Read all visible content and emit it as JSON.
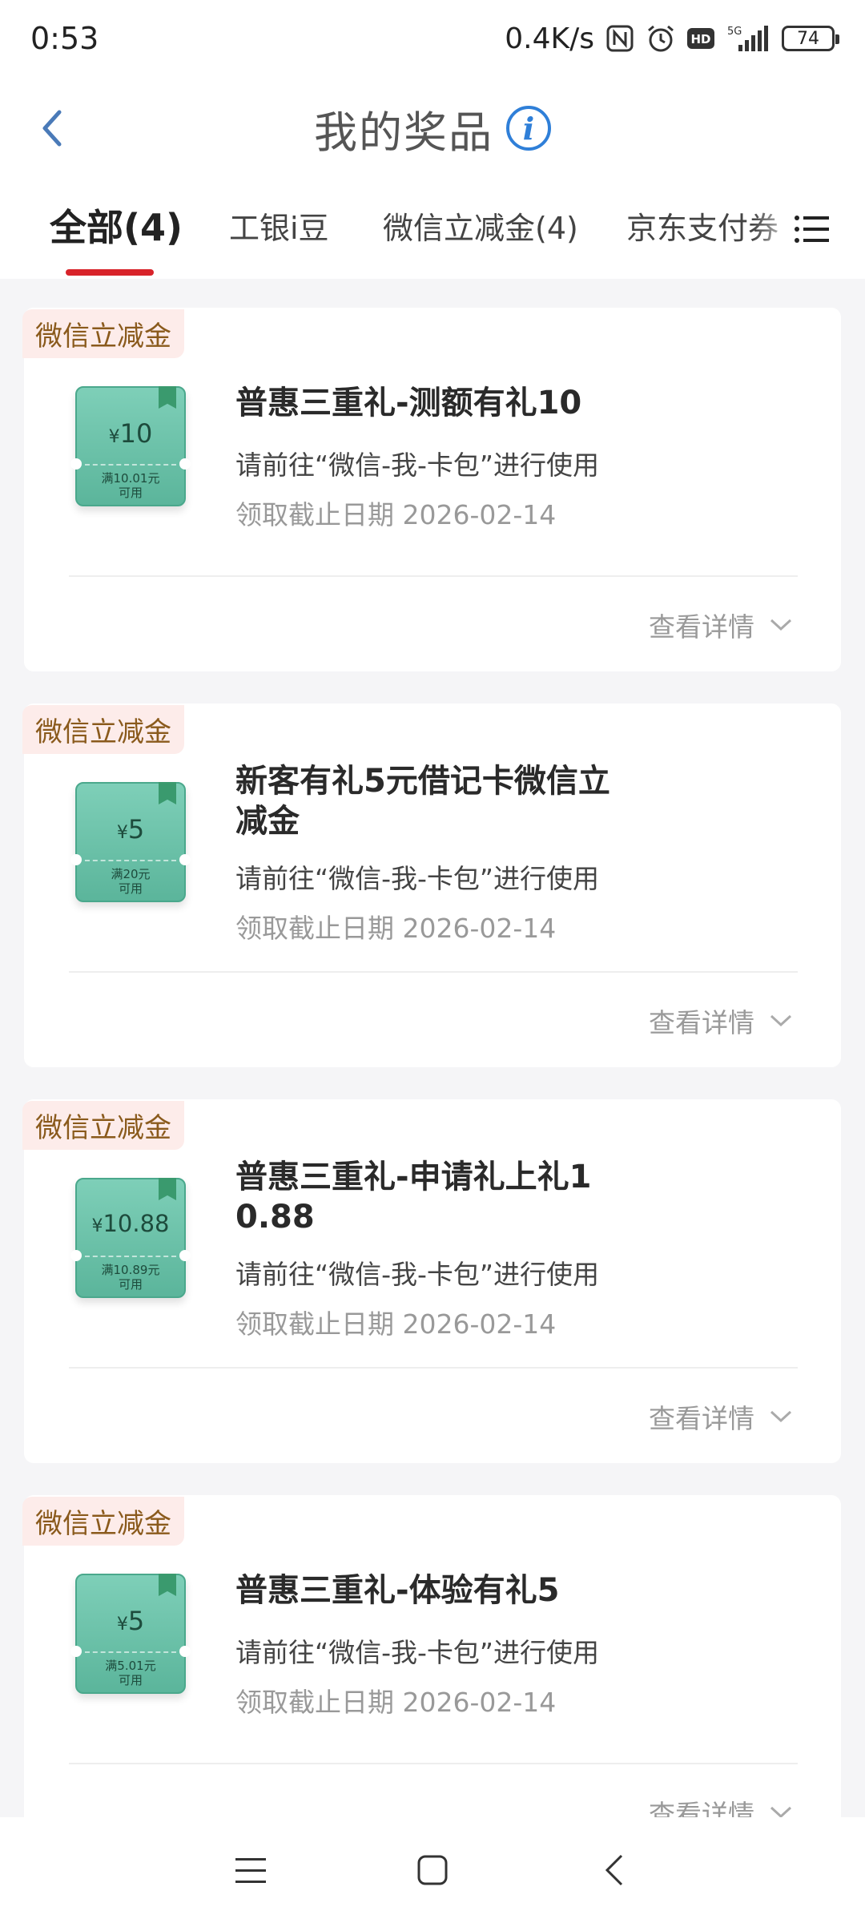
{
  "status_bar": {
    "time": "0:53",
    "speed": "0.4K/s",
    "battery": "74",
    "network": "5G",
    "hd": "HD",
    "icons": [
      "nfc-icon",
      "alarm-icon",
      "hd-icon",
      "5g-signal-icon",
      "battery-icon"
    ]
  },
  "header": {
    "back_icon": "chevron-left-icon",
    "title": "我的奖品",
    "info_icon": "info-icon",
    "info_glyph": "i"
  },
  "tabs": [
    {
      "label": "全部(4)",
      "active": true
    },
    {
      "label": "工银i豆",
      "active": false
    },
    {
      "label": "微信立减金(4)",
      "active": false
    },
    {
      "label": "京东支付券",
      "active": false
    }
  ],
  "tab_menu_icon": "list-menu-icon",
  "accent_color": "#d8232a",
  "cards": [
    {
      "tag": "微信立减金",
      "coupon_yen": "¥",
      "coupon_amount": "10",
      "coupon_condition": "满10.01元",
      "coupon_usable": "可用",
      "title": "普惠三重礼-测额有礼10",
      "desc": "请前往“微信-我-卡包”进行使用",
      "date": "领取截止日期 2026-02-14",
      "detail": "查看详情"
    },
    {
      "tag": "微信立减金",
      "coupon_yen": "¥",
      "coupon_amount": "5",
      "coupon_condition": "满20元",
      "coupon_usable": "可用",
      "title": "新客有礼5元借记卡微信立减金",
      "desc": "请前往“微信-我-卡包”进行使用",
      "date": "领取截止日期 2026-02-14",
      "detail": "查看详情"
    },
    {
      "tag": "微信立减金",
      "coupon_yen": "¥",
      "coupon_amount": "10.88",
      "coupon_condition": "满10.89元",
      "coupon_usable": "可用",
      "title": "普惠三重礼-申请礼上礼10.88",
      "desc": "请前往“微信-我-卡包”进行使用",
      "date": "领取截止日期 2026-02-14",
      "detail": "查看详情"
    },
    {
      "tag": "微信立减金",
      "coupon_yen": "¥",
      "coupon_amount": "5",
      "coupon_condition": "满5.01元",
      "coupon_usable": "可用",
      "title": "普惠三重礼-体验有礼5",
      "desc": "请前往“微信-我-卡包”进行使用",
      "date": "领取截止日期 2026-02-14",
      "detail": "查看详情"
    }
  ],
  "bottom_nav": {
    "icons": [
      "menu-icon",
      "home-square-icon",
      "back-icon"
    ]
  }
}
